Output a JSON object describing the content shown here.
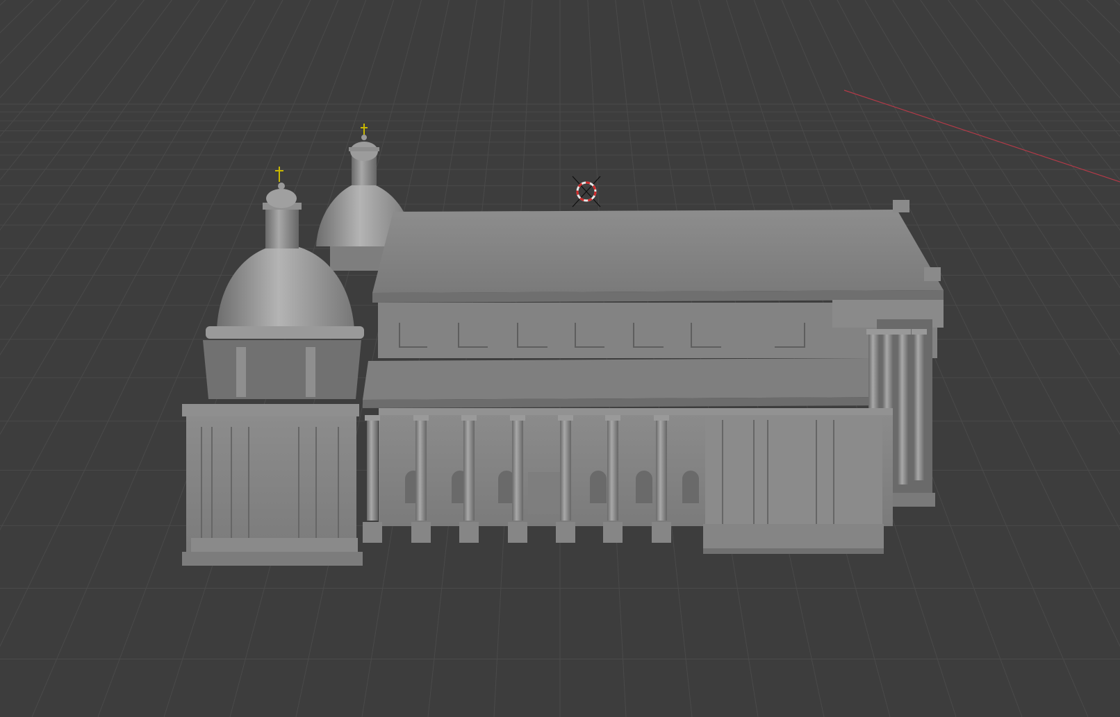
{
  "viewport": {
    "background_color": "#3d3d3d",
    "grid_color": "#4a4a4a",
    "x_axis_color": "#b33a48",
    "model": {
      "name": "cathedral",
      "surface_color": "#8a8a8a",
      "cross_color": "#c9b800",
      "dome_count": 2,
      "front_columns": 7,
      "portico_columns": 4
    },
    "cursor_3d": {
      "name": "3d-cursor-icon",
      "ring_colors": [
        "#e6e6e6",
        "#d12a2a"
      ]
    }
  }
}
